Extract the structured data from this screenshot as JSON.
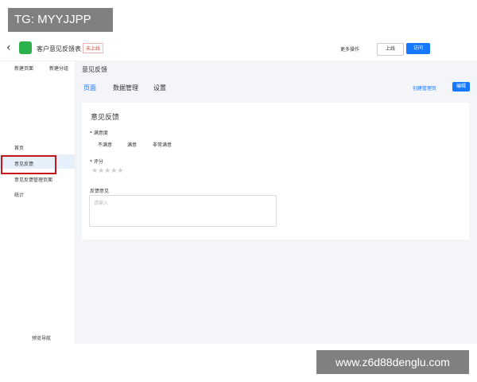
{
  "watermark_top": "TG: MYYJJPP",
  "watermark_bottom": "www.z6d88denglu.com",
  "header": {
    "title": "客户意见反馈表",
    "status": "未上线",
    "more": "更多操作",
    "publish": "上线",
    "visit": "访问"
  },
  "sidebar": {
    "new_page": "新建页面",
    "new_group": "新建分组",
    "items": [
      "首页",
      "意见反馈",
      "意见反馈管理页面",
      "统计"
    ],
    "preview": "预览导航"
  },
  "page_title": "意见反馈",
  "tabs": [
    "页面",
    "数据管理",
    "设置"
  ],
  "create_mgmt": "创建管理页",
  "edit": "编辑",
  "form": {
    "title": "意见反馈",
    "q1": "* 满意度",
    "opts": [
      "不满意",
      "满意",
      "非常满意"
    ],
    "q2": "* 评分",
    "q3": "反馈意见",
    "placeholder": "请输入"
  }
}
